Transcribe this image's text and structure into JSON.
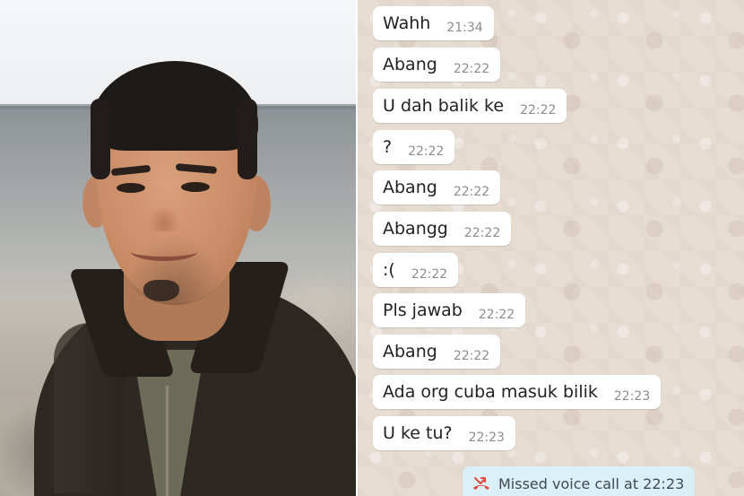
{
  "chat": {
    "messages": [
      {
        "text": "Wahh",
        "time": "21:34"
      },
      {
        "text": "Abang",
        "time": "22:22"
      },
      {
        "text": "U dah balik ke",
        "time": "22:22"
      },
      {
        "text": "?",
        "time": "22:22"
      },
      {
        "text": "Abang",
        "time": "22:22"
      },
      {
        "text": "Abangg",
        "time": "22:22"
      },
      {
        "text": ":(",
        "time": "22:22"
      },
      {
        "text": "Pls jawab",
        "time": "22:22"
      },
      {
        "text": "Abang",
        "time": "22:22"
      },
      {
        "text": "Ada org cuba masuk bilik",
        "time": "22:23"
      },
      {
        "text": "U ke tu?",
        "time": "22:23"
      }
    ],
    "missed_call": {
      "text": "Missed voice call at 22:23",
      "icon": "missed-call-icon",
      "icon_color": "#e0483d"
    },
    "bubble_color": "#ffffff",
    "system_bubble_color": "#dbeff6",
    "wallpaper_color": "#e6dcd2"
  },
  "photo": {
    "subject": "portrait-photo"
  }
}
